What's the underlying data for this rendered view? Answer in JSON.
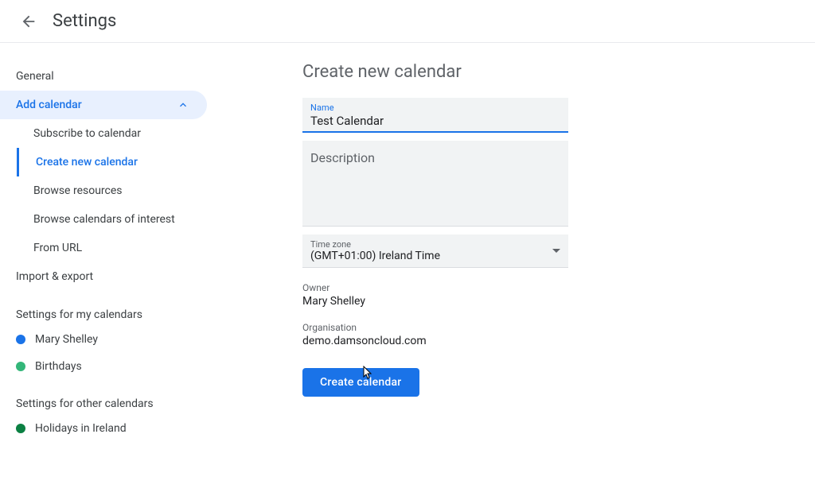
{
  "header": {
    "title": "Settings"
  },
  "sidebar": {
    "general": "General",
    "add_calendar": {
      "label": "Add calendar",
      "items": [
        "Subscribe to calendar",
        "Create new calendar",
        "Browse resources",
        "Browse calendars of interest",
        "From URL"
      ]
    },
    "import_export": "Import & export",
    "settings_my_calendars": {
      "label": "Settings for my calendars",
      "items": [
        {
          "name": "Mary Shelley",
          "color": "#1a73e8"
        },
        {
          "name": "Birthdays",
          "color": "#33b679"
        }
      ]
    },
    "settings_other_calendars": {
      "label": "Settings for other calendars",
      "items": [
        {
          "name": "Holidays in Ireland",
          "color": "#0b8043"
        }
      ]
    }
  },
  "main": {
    "title": "Create new calendar",
    "name_label": "Name",
    "name_value": "Test Calendar",
    "description_label": "Description",
    "timezone_label": "Time zone",
    "timezone_value": "(GMT+01:00) Ireland Time",
    "owner_label": "Owner",
    "owner_value": "Mary Shelley",
    "organisation_label": "Organisation",
    "organisation_value": "demo.damsoncloud.com",
    "create_button": "Create calendar"
  }
}
